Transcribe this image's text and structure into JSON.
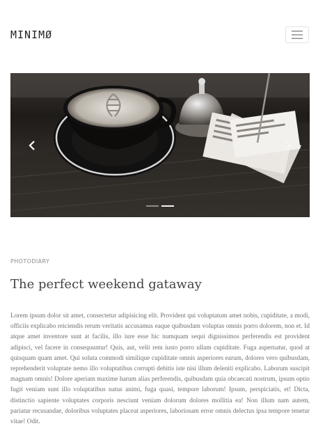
{
  "header": {
    "logo": "MINIMØ",
    "menu_icon": "hamburger-icon"
  },
  "carousel": {
    "image_description_icon": "coffee-cup-photo",
    "prev_icon": "chevron-left-icon",
    "next_icon": "chevron-right-icon",
    "slide_count": 2,
    "active_slide": 1
  },
  "post": {
    "category": "PHOTODIARY",
    "title": "The perfect weekend gataway",
    "body": "Lorem ipsum dolor sit amet, consectetur adipisicing elit. Provident qui voluptatum amet nobis, cupiditate, a modi, officiis explicabo reiciendis rerum veritatis accusamus eaque quibusdam voluptas omnis porro dolorem, non et. Id atque amet inventore sunt at facilis, illo iure esse hic numquam sequi dignissimos perferendis est provident adipisci, vel facere in consequuntur! Quis, aut, velit rem iusto porro ullam cupiditate. Fuga aspernatur, quod at quisquam quam amet. Qui soluta commodi similique cupiditate omnis asperiores earum, dolores vero quibusdam, reprehenderit voluptate nemo illo voluptatibus corrupti debitis iste nisi illum deleniti explicabo. Laborum suscipit magnam omnis! Dolore aperiam maxime harum alias perferendis, quibusdam quia obcaecati nostrum, ipsum optio fugit veniam sunt illo voluptatibus natus animi, fuga quasi, tempore laborum! Ipsum, perspiciatis, et! Dicta, distinctio sapiente voluptates corporis nesciunt veniam dolorum dolores mollitia ea! Non illum nam autem, pariatur recusandae, doloribus voluptates placeat asperiores, laboriosam error omnis delectus ipsa tempore tenetur vitae! Odit."
  }
}
